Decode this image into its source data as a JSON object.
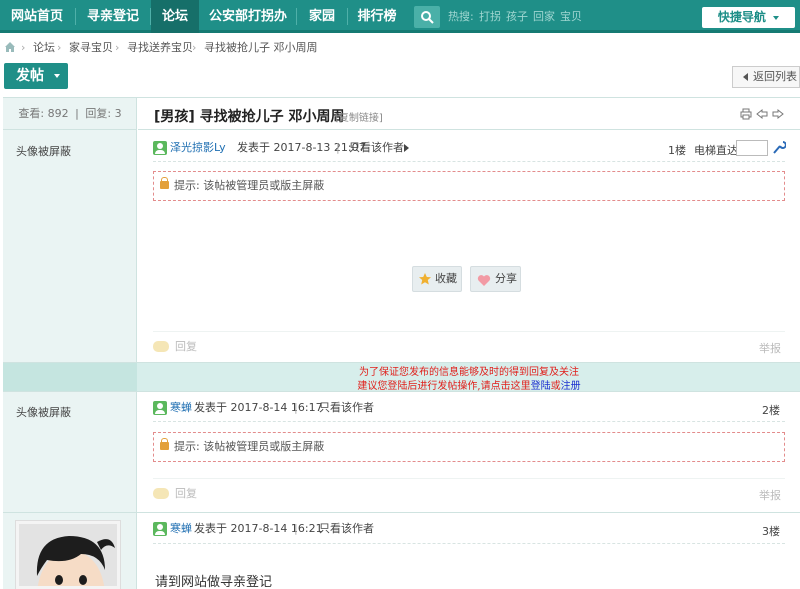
{
  "nav": {
    "items": [
      "网站首页",
      "寻亲登记",
      "论坛",
      "公安部打拐办",
      "家园",
      "排行榜"
    ],
    "hot_label": "热搜:",
    "hot_words": [
      "打拐",
      "孩子",
      "回家",
      "宝贝"
    ],
    "quick_nav": "快捷导航"
  },
  "breadcrumb": [
    "论坛",
    "家寻宝贝",
    "寻找送养宝贝",
    "寻找被抢儿子 邓小周周"
  ],
  "actions": {
    "post": "发帖",
    "back": "返回列表"
  },
  "thread": {
    "stats": {
      "views_label": "查看:",
      "views": "892",
      "sep": "|",
      "replies_label": "回复:",
      "replies": "3"
    },
    "title": "[男孩] 寻找被抢儿子 邓小周周",
    "copy_link": "[复制链接]"
  },
  "posts": [
    {
      "avatar_text": "头像被屏蔽",
      "author": "泽光掠影Ly",
      "posted": "发表于 2017-8-13 21:07",
      "sep": "|",
      "only_author": "只看该作者",
      "floor": "1楼",
      "jump_label": "电梯直达",
      "notice": "提示: 该帖被管理员或版主屏蔽",
      "fav": "收藏",
      "share": "分享",
      "reply": "回复",
      "report": "举报"
    },
    {
      "avatar_text": "头像被屏蔽",
      "author": "寒蝉",
      "posted": "发表于 2017-8-14 16:17",
      "sep": "|",
      "only_author": "只看该作者",
      "floor": "2楼",
      "notice": "提示: 该帖被管理员或版主屏蔽",
      "reply": "回复",
      "report": "举报"
    },
    {
      "author": "寒蝉",
      "posted": "发表于 2017-8-14 16:21",
      "sep": "|",
      "only_author": "只看该作者",
      "floor": "3楼",
      "body": "请到网站做寻亲登记"
    }
  ],
  "login_warning": {
    "line1": "为了保证您发布的信息能够及时的得到回复及关注",
    "line2_pre": "建议您登陆后进行发帖操作,请点击这里",
    "login": "登陆",
    "or": "或",
    "register": "注册"
  },
  "colors": {
    "brand": "#1f8f88",
    "warning": "#e0201c",
    "link": "#1a2ecf"
  }
}
